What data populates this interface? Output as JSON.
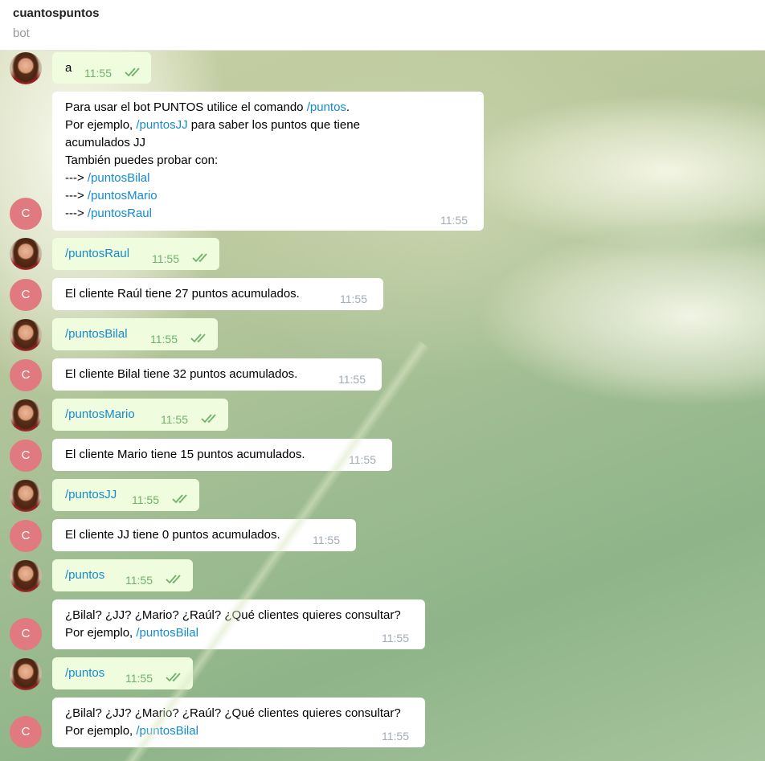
{
  "chat": {
    "title": "cuantospuntos",
    "subtitle": "bot",
    "bot_initial": "C",
    "messages": [
      {
        "text": "a",
        "time": "11:55"
      },
      {
        "lines": [
          "Para usar el bot PUNTOS utilice el comando ",
          "/puntos",
          ".",
          "Por ejemplo, ",
          "/puntosJJ",
          " para saber los puntos que tiene",
          "acumulados JJ",
          "También puedes probar con:",
          "---> ",
          "/puntosBilal",
          "---> ",
          "/puntosMario",
          "---> ",
          "/puntosRaul"
        ],
        "time": "11:55"
      },
      {
        "text": "/puntosRaul",
        "time": "11:55"
      },
      {
        "text": "El cliente Raúl tiene 27 puntos acumulados.",
        "time": "11:55"
      },
      {
        "text": "/puntosBilal",
        "time": "11:55"
      },
      {
        "text": "El cliente Bilal tiene 32 puntos acumulados.",
        "time": "11:55"
      },
      {
        "text": "/puntosMario",
        "time": "11:55"
      },
      {
        "text": "El cliente Mario tiene 15 puntos acumulados.",
        "time": "11:55"
      },
      {
        "text": "/puntosJJ",
        "time": "11:55"
      },
      {
        "text": "El cliente JJ tiene 0 puntos acumulados.",
        "time": "11:55"
      },
      {
        "text": "/puntos",
        "time": "11:55"
      },
      {
        "line1": "¿Bilal? ¿JJ? ¿Mario? ¿Raúl? ¿Qué clientes quieres consultar?",
        "line2_prefix": "Por ejemplo, ",
        "line2_link": "/puntosBilal",
        "time": "11:55"
      },
      {
        "text": "/puntos",
        "time": "11:55"
      },
      {
        "line1": "¿Bilal? ¿JJ? ¿Mario? ¿Raúl? ¿Qué clientes quieres consultar?",
        "line2_prefix": "Por ejemplo, ",
        "line2_link": "/puntosBilal",
        "time": "11:55"
      }
    ]
  },
  "colors": {
    "outgoing_bubble": "#effdde",
    "incoming_bubble": "#ffffff",
    "link": "#168acd",
    "read_check": "#6cb26a",
    "bot_avatar": "#e07a80"
  },
  "icons": {
    "read_receipt": "double-check-icon"
  }
}
